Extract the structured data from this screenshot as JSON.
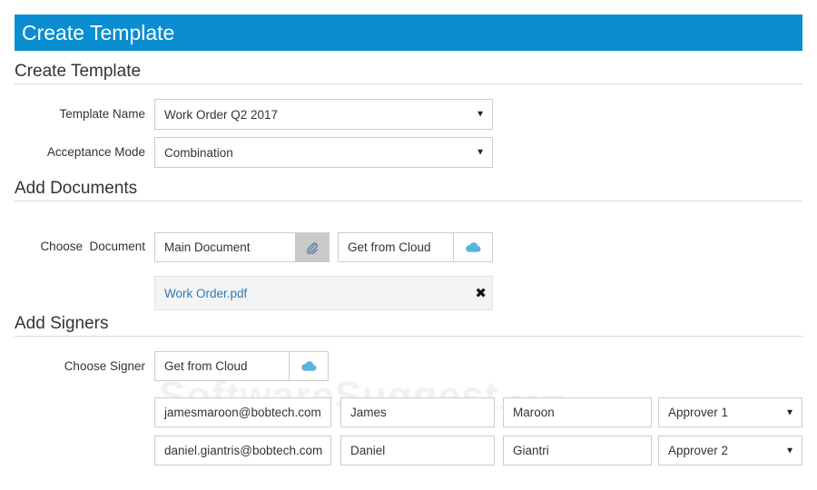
{
  "header": {
    "title": "Create Template"
  },
  "sections": {
    "create_template": "Create Template",
    "add_documents": "Add Documents",
    "add_signers": "Add Signers"
  },
  "template_form": {
    "template_name": {
      "label": "Template Name",
      "value": "Work Order Q2 2017"
    },
    "acceptance_mode": {
      "label": "Acceptance Mode",
      "value": "Combination"
    }
  },
  "documents": {
    "choose_label": "Choose  Document",
    "main_document": "Main Document",
    "get_from_cloud": "Get from Cloud",
    "attached_files": [
      {
        "name": "Work Order.pdf"
      }
    ]
  },
  "signers": {
    "choose_label": "Choose Signer",
    "get_from_cloud": "Get from Cloud",
    "rows": [
      {
        "email": "jamesmaroon@bobtech.com",
        "first_name": "James",
        "last_name": "Maroon",
        "role": "Approver 1"
      },
      {
        "email": "daniel.giantris@bobtech.com",
        "first_name": "Daniel",
        "last_name": "Giantri",
        "role": "Approver 2"
      }
    ]
  },
  "watermark": {
    "main": "SoftwareSuggest",
    "suffix": ".com"
  },
  "colors": {
    "header": "#0a8ed1",
    "cloud_icon": "#5ab4dd",
    "link": "#2f7ab8"
  },
  "icons": {
    "attach": "paperclip-icon",
    "cloud": "cloud-icon",
    "remove": "close-icon",
    "dropdown": "caret-down-icon"
  }
}
